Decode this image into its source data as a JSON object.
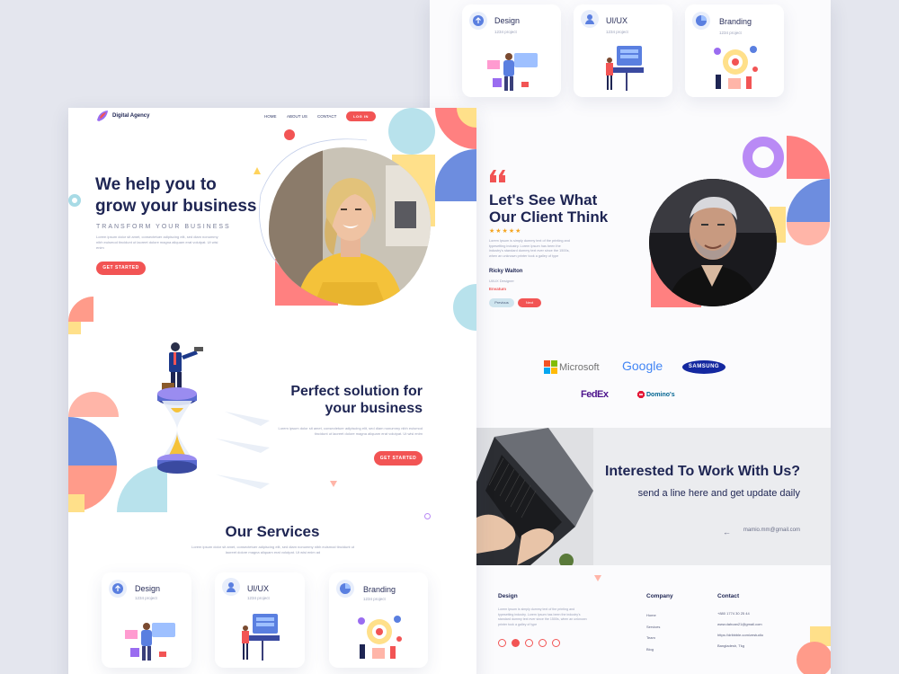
{
  "header": {
    "logo_text": "Digital Agency",
    "nav": [
      "HOME",
      "ABOUT US",
      "CONTACT"
    ],
    "login_label": "LOG IN"
  },
  "hero": {
    "title_line1": "We help you to",
    "title_line2": "grow your business",
    "subtitle": "TRANSFORM YOUR BUSINESS",
    "body": "Lorem ipsum dolor sit amet, consectetuer adipiscing elit, sed diam nonummy nibh euismod tincidunt ut laoreet dolore magna aliquam erat volutpat. Ut wisi enim",
    "cta_label": "GET STARTED"
  },
  "solution": {
    "title_line1": "Perfect solution for",
    "title_line2": "your business",
    "body": "Lorem ipsum dolor sit amet, consectetuer adipiscing elit, sed diam nonummy nibh euismod tincidunt ut laoreet dolore magna aliquam erat volutpat. Ut wisi enim",
    "cta_label": "GET STARTED"
  },
  "services": {
    "title": "Our Services",
    "body": "Lorem ipsum dolor sit amet, consectetuer adipiscing elit, sed diam nonummy nibh euismod tincidunt ut laoreet dolore magna aliquam erat volutpat. Ut wisi enim ad",
    "cards": [
      {
        "title": "Design",
        "sub": "1234 project",
        "icon": "upload-cloud-icon"
      },
      {
        "title": "UI/UX",
        "sub": "1234 project",
        "icon": "person-icon"
      },
      {
        "title": "Branding",
        "sub": "1234 project",
        "icon": "pie-chart-icon"
      }
    ]
  },
  "testimonial": {
    "title_line1": "Let's See What",
    "title_line2": "Our Client Think",
    "stars": "★★★★★",
    "body": "Lorem Ipsum is simply dummy text of the printing and typesetting industry. Lorem Ipsum has been the industry's standard dummy text ever since the 1500s, when an unknown printer took a galley of type",
    "name": "Ricky Walton",
    "role": "UI/UX Designer",
    "company": "Envatum",
    "prev_label": "Previous",
    "next_label": "Next"
  },
  "brands": [
    "Microsoft",
    "Google",
    "SAMSUNG",
    "FedEx",
    "Domino's"
  ],
  "cta": {
    "title": "Interested To Work With Us?",
    "subtitle": "send a line here and get update daily",
    "email": "mamio.mm@gmail.com"
  },
  "footer": {
    "brand_title": "Design",
    "brand_body": "Lorem Ipsum is simply dummy text of the printing and typesetting industry. Lorem Ipsum has been the industry's standard dummy text ever since the 1500s, when an unknown printer took a galley of type",
    "company_title": "Company",
    "company_links": [
      "Home",
      "Services",
      "Team",
      "Blog"
    ],
    "contact_title": "Contact",
    "contact_lines": [
      "+880 1774 30 25 44",
      "www.dahoan21@gmail.com",
      "https://dribbble.com/zestudio",
      "Bangladesh, Tkg"
    ]
  },
  "colors": {
    "accent": "#f25454",
    "navy": "#1e2553",
    "purple": "#9a6cf0",
    "blue": "#6d8ddf",
    "yellow": "#ffe08a",
    "teal": "#a8dbe6",
    "pink": "#ffb5a8"
  }
}
